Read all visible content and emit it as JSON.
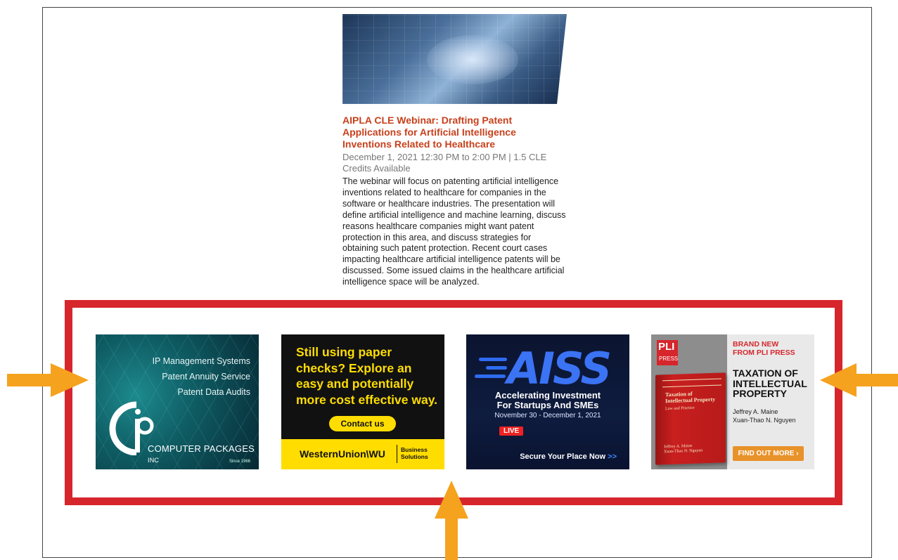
{
  "event": {
    "title": "AIPLA CLE Webinar: Drafting Patent Applications for Artificial Intelligence Inventions Related to Healthcare",
    "meta": "December 1, 2021 12:30 PM to 2:00 PM  |  1.5 CLE Credits Available",
    "description": "The webinar will focus on patenting artificial intelligence inventions related to healthcare for companies in the software or healthcare industries. The presentation will define artificial intelligence and machine learning, discuss reasons healthcare companies might want patent protection in this area, and discuss strategies for obtaining such patent protection. Recent court cases impacting healthcare artificial intelligence patents will be discussed. Some issued claims in the healthcare artificial intelligence space will be analyzed."
  },
  "ads": {
    "computer_packages": {
      "lines": [
        "IP Management Systems",
        "Patent Annuity Service",
        "Patent Data Audits"
      ],
      "brand": "COMPUTER PACKAGES",
      "brand_suffix": "INC",
      "since": "Since 1966"
    },
    "western_union": {
      "headline": "Still using paper checks? Explore an easy and potentially more cost effective way.",
      "cta": "Contact us",
      "logo": "WesternUnion\\WU",
      "business": "Business",
      "solutions": "Solutions"
    },
    "aiss": {
      "logo": "AISS",
      "line1": "Accelerating Investment",
      "line2": "For Startups And SMEs",
      "dates": "November 30 - December 1, 2021",
      "live": "LIVE",
      "cta": "Secure Your Place Now",
      "cta_arrows": ">>"
    },
    "pli": {
      "logo_top": "PLI",
      "logo_bottom": "PRESS",
      "new_line1": "BRAND NEW",
      "new_line2": "FROM PLI PRESS",
      "title_line1": "TAXATION OF",
      "title_line2": "INTELLECTUAL",
      "title_line3": "PROPERTY",
      "author1": "Jeffrey A. Maine",
      "author2": "Xuan-Thao N. Nguyen",
      "cta": "FIND OUT MORE ›",
      "book_title1": "Taxation of",
      "book_title2": "Intellectual Property",
      "book_subtitle": "Law and Practice",
      "book_author1": "Jeffrey A. Maine",
      "book_author2": "Xuan-Thao N. Nguyen"
    }
  },
  "colors": {
    "highlight_border": "#d6262c",
    "arrow": "#f5a21e",
    "event_title": "#c8401c"
  }
}
